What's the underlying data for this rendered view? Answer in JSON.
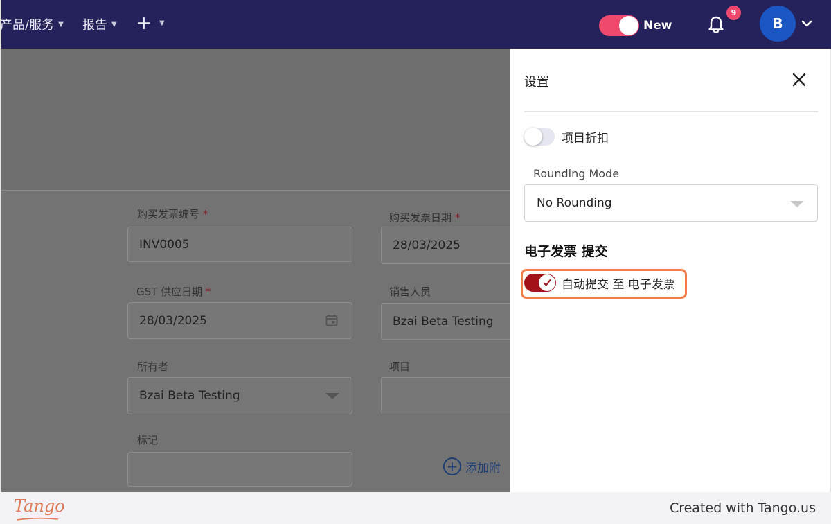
{
  "topbar": {
    "nav_products": "产品/服务",
    "nav_reports": "报告",
    "nav_add": "+",
    "toggle_new_label": "New",
    "notification_count": "9",
    "avatar_initial": "B",
    "colors": {
      "bar": "#25215a",
      "accent": "#ef4a6e",
      "avatar": "#1a56c4"
    }
  },
  "form": {
    "invoice_number_label": "购买发票编号",
    "invoice_number_value": "INV0005",
    "invoice_date_label": "购买发票日期",
    "invoice_date_value": "28/03/2025",
    "gst_date_label": "GST 供应日期",
    "gst_date_value": "28/03/2025",
    "salesperson_label": "销售人员",
    "salesperson_value": "Bzai Beta Testing",
    "owner_label": "所有者",
    "owner_value": "Bzai Beta Testing",
    "project_label": "项目",
    "project_value": "",
    "tags_label": "标记",
    "tags_value": "",
    "add_attachment_label": "添加附",
    "required_mark": "*"
  },
  "settings_panel": {
    "title": "设置",
    "item_discount_label": "项目折扣",
    "item_discount_on": false,
    "rounding_mode_label": "Rounding Mode",
    "rounding_mode_value": "No Rounding",
    "einvoice_heading": "电子发票 提交",
    "auto_submit_label": "自动提交 至 电子发票",
    "auto_submit_on": true,
    "colors": {
      "toggle_on": "#a1121a",
      "highlight": "#f07f4a"
    }
  },
  "footer": {
    "brand": "Tango",
    "credit": "Created with Tango.us"
  }
}
